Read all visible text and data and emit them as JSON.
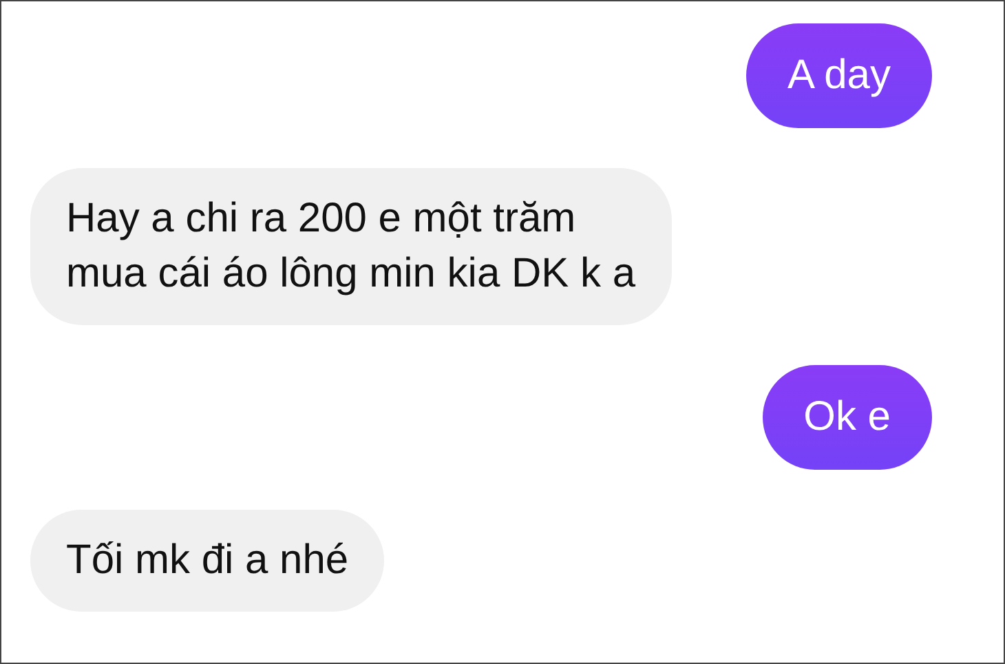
{
  "messages": [
    {
      "kind": "sent",
      "text": "A day"
    },
    {
      "kind": "received",
      "text": "Hay a chi ra 200 e một trăm\nmua cái áo lông min kia DK k a"
    },
    {
      "kind": "sent",
      "text": "Ok e"
    },
    {
      "kind": "received",
      "text": "Tối mk đi a nhé"
    }
  ]
}
